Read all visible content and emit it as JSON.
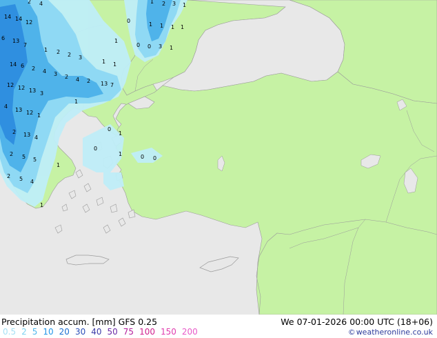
{
  "footer": {
    "title": "Precipitation accum. [mm] GFS 0.25",
    "datetime": "We 07-01-2026 00:00 UTC (18+06)",
    "credit_symbol": "©",
    "credit": "weatheronline.co.uk"
  },
  "legend": [
    {
      "label": "0.5",
      "color": "#a6e1f5"
    },
    {
      "label": "2",
      "color": "#7dd3f1"
    },
    {
      "label": "5",
      "color": "#4fb8ee"
    },
    {
      "label": "10",
      "color": "#2196e8"
    },
    {
      "label": "20",
      "color": "#1b6fd2"
    },
    {
      "label": "30",
      "color": "#2a4eb8"
    },
    {
      "label": "40",
      "color": "#3b3aa8"
    },
    {
      "label": "50",
      "color": "#6a2aa6"
    },
    {
      "label": "75",
      "color": "#b41f9c"
    },
    {
      "label": "100",
      "color": "#d0208e"
    },
    {
      "label": "150",
      "color": "#e03cae"
    },
    {
      "label": "200",
      "color": "#e85ac8"
    }
  ],
  "colors": {
    "sea": "#e8e8e8",
    "land": "#c6f2a4",
    "border": "#9a9a9a",
    "precip_light": "#bfeef8",
    "precip_mid": "#8fd9f4",
    "precip_heavy": "#4fb3ea",
    "precip_max": "#2f8fe0"
  },
  "precip_values": [
    {
      "v": "2"
    },
    {
      "v": "4"
    },
    {
      "v": "1"
    },
    {
      "v": "2"
    },
    {
      "v": "3"
    },
    {
      "v": "1"
    },
    {
      "v": "14"
    },
    {
      "v": "14"
    },
    {
      "v": "12"
    },
    {
      "v": "0"
    },
    {
      "v": "1"
    },
    {
      "v": "1"
    },
    {
      "v": "1"
    },
    {
      "v": "1"
    },
    {
      "v": "6"
    },
    {
      "v": "13"
    },
    {
      "v": "7"
    },
    {
      "v": "1"
    },
    {
      "v": "0"
    },
    {
      "v": "0"
    },
    {
      "v": "3"
    },
    {
      "v": "1"
    },
    {
      "v": "1"
    },
    {
      "v": "2"
    },
    {
      "v": "2"
    },
    {
      "v": "3"
    },
    {
      "v": "14"
    },
    {
      "v": "6"
    },
    {
      "v": "2"
    },
    {
      "v": "4"
    },
    {
      "v": "3"
    },
    {
      "v": "1"
    },
    {
      "v": "1"
    },
    {
      "v": "2"
    },
    {
      "v": "4"
    },
    {
      "v": "2"
    },
    {
      "v": "13"
    },
    {
      "v": "7"
    },
    {
      "v": "12"
    },
    {
      "v": "12"
    },
    {
      "v": "13"
    },
    {
      "v": "3"
    },
    {
      "v": "1"
    },
    {
      "v": "4"
    },
    {
      "v": "13"
    },
    {
      "v": "12"
    },
    {
      "v": "1"
    },
    {
      "v": "2"
    },
    {
      "v": "13"
    },
    {
      "v": "4"
    },
    {
      "v": "0"
    },
    {
      "v": "1"
    },
    {
      "v": "2"
    },
    {
      "v": "5"
    },
    {
      "v": "5"
    },
    {
      "v": "0"
    },
    {
      "v": "1"
    },
    {
      "v": "0"
    },
    {
      "v": "0"
    },
    {
      "v": "2"
    },
    {
      "v": "5"
    },
    {
      "v": "4"
    },
    {
      "v": "1"
    },
    {
      "v": "1"
    }
  ]
}
